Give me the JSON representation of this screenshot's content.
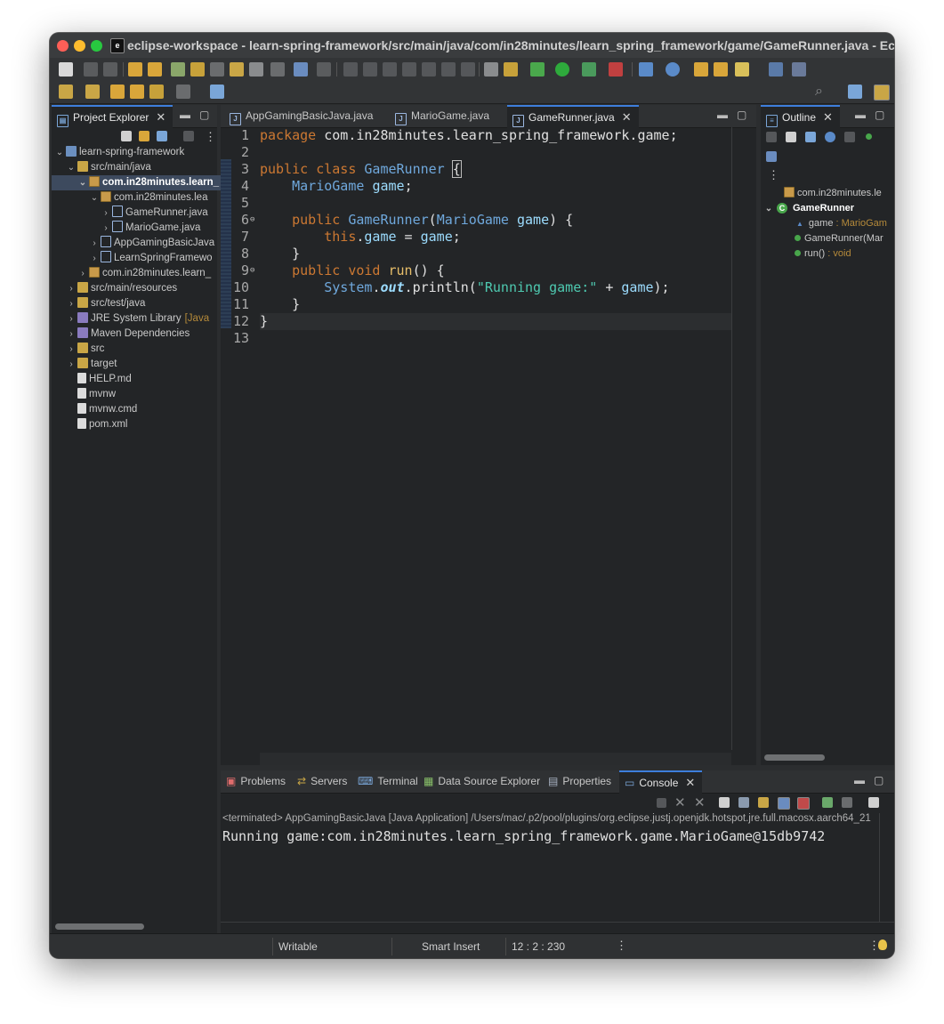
{
  "window": {
    "title": "eclipse-workspace - learn-spring-framework/src/main/java/com/in28minutes/learn_spring_framework/game/GameRunner.java - Ecli..."
  },
  "project_explorer": {
    "tab_label": "Project Explorer",
    "tree": [
      {
        "label": "learn-spring-framework",
        "icon": "project-icon",
        "indent": 0,
        "chevron": "down"
      },
      {
        "label": "src/main/java",
        "icon": "source-folder-icon",
        "indent": 1,
        "chevron": "down"
      },
      {
        "label": "com.in28minutes.learn_",
        "icon": "package-icon",
        "indent": 2,
        "chevron": "down",
        "selected": true
      },
      {
        "label": "com.in28minutes.lea",
        "icon": "package-icon",
        "indent": 3,
        "chevron": "down"
      },
      {
        "label": "GameRunner.java",
        "icon": "java-file-icon",
        "indent": 4,
        "chevron": "right"
      },
      {
        "label": "MarioGame.java",
        "icon": "java-file-icon",
        "indent": 4,
        "chevron": "right"
      },
      {
        "label": "AppGamingBasicJava",
        "icon": "java-file-icon",
        "indent": 3,
        "chevron": "right"
      },
      {
        "label": "LearnSpringFramewo",
        "icon": "java-file-icon",
        "indent": 3,
        "chevron": "right"
      },
      {
        "label": "com.in28minutes.learn_",
        "icon": "package-icon",
        "indent": 2,
        "chevron": "right"
      },
      {
        "label": "src/main/resources",
        "icon": "source-folder-icon",
        "indent": 1,
        "chevron": "right"
      },
      {
        "label": "src/test/java",
        "icon": "source-folder-icon",
        "indent": 1,
        "chevron": "right"
      },
      {
        "label": "JRE System Library",
        "suffix": "[Java",
        "icon": "library-icon",
        "indent": 1,
        "chevron": "right"
      },
      {
        "label": "Maven Dependencies",
        "icon": "library-icon",
        "indent": 1,
        "chevron": "right"
      },
      {
        "label": "src",
        "icon": "folder-icon",
        "indent": 1,
        "chevron": "right"
      },
      {
        "label": "target",
        "icon": "folder-icon",
        "indent": 1,
        "chevron": "right"
      },
      {
        "label": "HELP.md",
        "icon": "markdown-file-icon",
        "indent": 1,
        "chevron": ""
      },
      {
        "label": "mvnw",
        "icon": "file-icon",
        "indent": 1,
        "chevron": ""
      },
      {
        "label": "mvnw.cmd",
        "icon": "file-icon",
        "indent": 1,
        "chevron": ""
      },
      {
        "label": "pom.xml",
        "icon": "xml-file-icon",
        "indent": 1,
        "chevron": ""
      }
    ]
  },
  "editor": {
    "tabs": [
      {
        "label": "AppGamingBasicJava.java",
        "active": false
      },
      {
        "label": "MarioGame.java",
        "active": false
      },
      {
        "label": "GameRunner.java",
        "active": true
      }
    ],
    "lines": [
      {
        "n": "1",
        "marker": ""
      },
      {
        "n": "2",
        "marker": ""
      },
      {
        "n": "3",
        "marker": ""
      },
      {
        "n": "4",
        "marker": ""
      },
      {
        "n": "5",
        "marker": ""
      },
      {
        "n": "6",
        "marker": "⊖"
      },
      {
        "n": "7",
        "marker": ""
      },
      {
        "n": "8",
        "marker": ""
      },
      {
        "n": "9",
        "marker": "⊖"
      },
      {
        "n": "10",
        "marker": ""
      },
      {
        "n": "11",
        "marker": ""
      },
      {
        "n": "12",
        "marker": ""
      },
      {
        "n": "13",
        "marker": ""
      }
    ],
    "code": {
      "l1_kw": "package",
      "l1_rest": " com.in28minutes.learn_spring_framework.game;",
      "l3_kw": "public class",
      "l3_name": "GameRunner",
      "l3_brace": "{",
      "l4_type": "MarioGame",
      "l4_field": "game",
      "l4_end": ";",
      "l6_kw": "public",
      "l6_name": "GameRunner",
      "l6_paren": "(",
      "l6_type": "MarioGame",
      "l6_param": "game",
      "l6_end": ") {",
      "l7_kw": "this",
      "l7_dot": ".",
      "l7_field": "game",
      "l7_eq": " = ",
      "l7_param": "game",
      "l7_end": ";",
      "l8": "}",
      "l9_kw": "public void",
      "l9_name": "run",
      "l9_end": "() {",
      "l10_type": "System",
      "l10_dot1": ".",
      "l10_static": "out",
      "l10_call": ".println(",
      "l10_str": "\"Running game:\"",
      "l10_plus": " + ",
      "l10_field": "game",
      "l10_end": ");",
      "l11": "}",
      "l12": "}"
    }
  },
  "outline": {
    "tab_label": "Outline",
    "rows": [
      {
        "label": "com.in28minutes.le",
        "type": ""
      },
      {
        "label": "GameRunner",
        "type": ""
      },
      {
        "label": "game",
        "type": " : MarioGam"
      },
      {
        "label": "GameRunner(Mar",
        "type": ""
      },
      {
        "label": "run()",
        "type": " : void"
      }
    ]
  },
  "bottom": {
    "tabs": [
      {
        "label": "Problems",
        "icon": "problems-icon"
      },
      {
        "label": "Servers",
        "icon": "servers-icon"
      },
      {
        "label": "Terminal",
        "icon": "terminal-icon"
      },
      {
        "label": "Data Source Explorer",
        "icon": "data-source-icon"
      },
      {
        "label": "Properties",
        "icon": "properties-icon"
      },
      {
        "label": "Console",
        "icon": "console-icon",
        "active": true
      }
    ],
    "console_header": "<terminated> AppGamingBasicJava [Java Application] /Users/mac/.p2/pool/plugins/org.eclipse.justj.openjdk.hotspot.jre.full.macosx.aarch64_21",
    "console_output": "Running game:com.in28minutes.learn_spring_framework.game.MarioGame@15db9742"
  },
  "status": {
    "writable": "Writable",
    "insert_mode": "Smart Insert",
    "position": "12 : 2 : 230"
  },
  "colors": {
    "accent": "#3d7edc",
    "keyword": "#cc7832",
    "type": "#6fa8dc",
    "string": "#4ec9b0"
  }
}
